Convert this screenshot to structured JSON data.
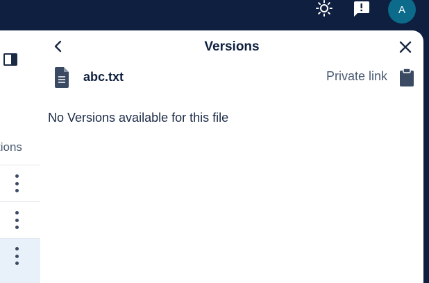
{
  "topbar": {
    "icons": [
      "sun-icon",
      "feedback-icon"
    ],
    "avatar_initial": "A",
    "avatar_color": "#0c6b8a",
    "background": "#0e1f3f"
  },
  "files": {
    "actions_header": "tions",
    "row_menu_icon": "kebab-icon"
  },
  "panel": {
    "title": "Versions",
    "back_icon": "chevron-left-icon",
    "close_icon": "close-icon",
    "file": {
      "icon": "text-file-icon",
      "name": "abc.txt"
    },
    "private_link_label": "Private link",
    "private_link_icon": "clipboard-icon",
    "empty_message": "No Versions available for this file"
  }
}
